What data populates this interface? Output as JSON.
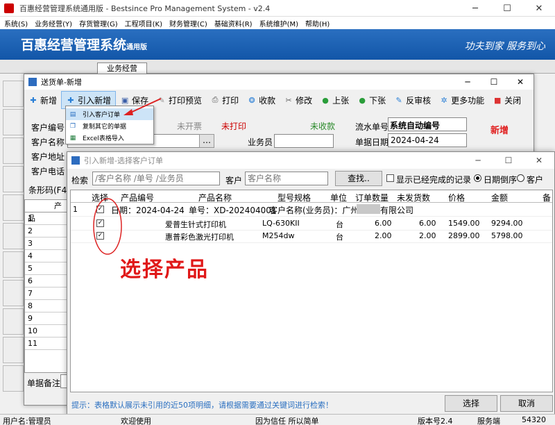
{
  "window": {
    "title": "百惠经营管理系统通用版 - Bestsince Pro Management System - v2.4"
  },
  "menu": [
    "系统(S)",
    "业务经营(Y)",
    "存货管理(G)",
    "工程项目(K)",
    "财务管理(C)",
    "基础资料(R)",
    "系统维护(M)",
    "帮助(H)"
  ],
  "banner": {
    "title": "百惠经营管理系统",
    "edition": "通用版",
    "slogan": "功夫到家 服务到心"
  },
  "main_tab": "业务经营",
  "dialog1": {
    "title": "送货单-新增",
    "toolbar": [
      "新增",
      "引入新增",
      "保存",
      "打印预览",
      "打印",
      "收款",
      "修改",
      "上张",
      "下张",
      "反审核",
      "更多功能",
      "关闭"
    ],
    "dropdown": [
      "引入客户订单",
      "复制其它的单据",
      "Excel表格导入"
    ],
    "status": {
      "invoice": "未开票",
      "print": "未打印",
      "receipt": "未收款",
      "new": "新增"
    },
    "labels": {
      "customer_no": "客户编号",
      "customer_name": "客户名称",
      "customer_addr": "客户地址",
      "customer_tel": "客户电话",
      "serial": "流水单号",
      "salesman": "业务员",
      "date": "单据日期",
      "barcode": "条形码(F4)",
      "product_col": "产品",
      "remark": "单据备注"
    },
    "values": {
      "serial": "系统自动编号",
      "date": "2024-04-24"
    },
    "row_numbers": [
      "1",
      "2",
      "3",
      "4",
      "5",
      "6",
      "7",
      "8",
      "9",
      "10",
      "11"
    ]
  },
  "dialog2": {
    "title": "引入新增-选择客户订单",
    "search_label": "检索",
    "search_placeholder": "/客户名称 /单号 /业务员",
    "customer_label": "客户",
    "customer_placeholder": "客户名称",
    "find_btn": "查找..",
    "show_done": "显示已经完成的记录",
    "radio_date": "日期倒序",
    "radio_customer": "客户",
    "columns": [
      "选择",
      "产品编号",
      "产品名称",
      "型号规格",
      "单位",
      "订单数量",
      "未发货数",
      "价格",
      "金额",
      "备"
    ],
    "group": {
      "index": "1",
      "date_label": "日期：2024-04-24",
      "order_label": "单号：XD-202404001",
      "customer_label": "客户名称(业务员)：广州",
      "customer_tail": "有限公司"
    },
    "rows": [
      {
        "name": "爱普生针式打印机",
        "model": "LQ-630KII",
        "unit": "台",
        "qty": "6.00",
        "unshipped": "6.00",
        "price": "1549.00",
        "amount": "9294.00"
      },
      {
        "name": "惠普彩色激光打印机",
        "model": "M254dw",
        "unit": "台",
        "qty": "2.00",
        "unshipped": "2.00",
        "price": "2899.00",
        "amount": "5798.00"
      }
    ],
    "annotation": "选择产品",
    "tip": "提示：表格默认展示未引用的近50项明细，请根据需要通过关键词进行检索！",
    "select_btn": "选择",
    "cancel_btn": "取消"
  },
  "statusbar": {
    "user": "用户名:管理员",
    "welcome": "欢迎使用",
    "motto": "因为信任 所以简单",
    "version": "版本号2.4",
    "service": "服务端",
    "port": "54320"
  }
}
